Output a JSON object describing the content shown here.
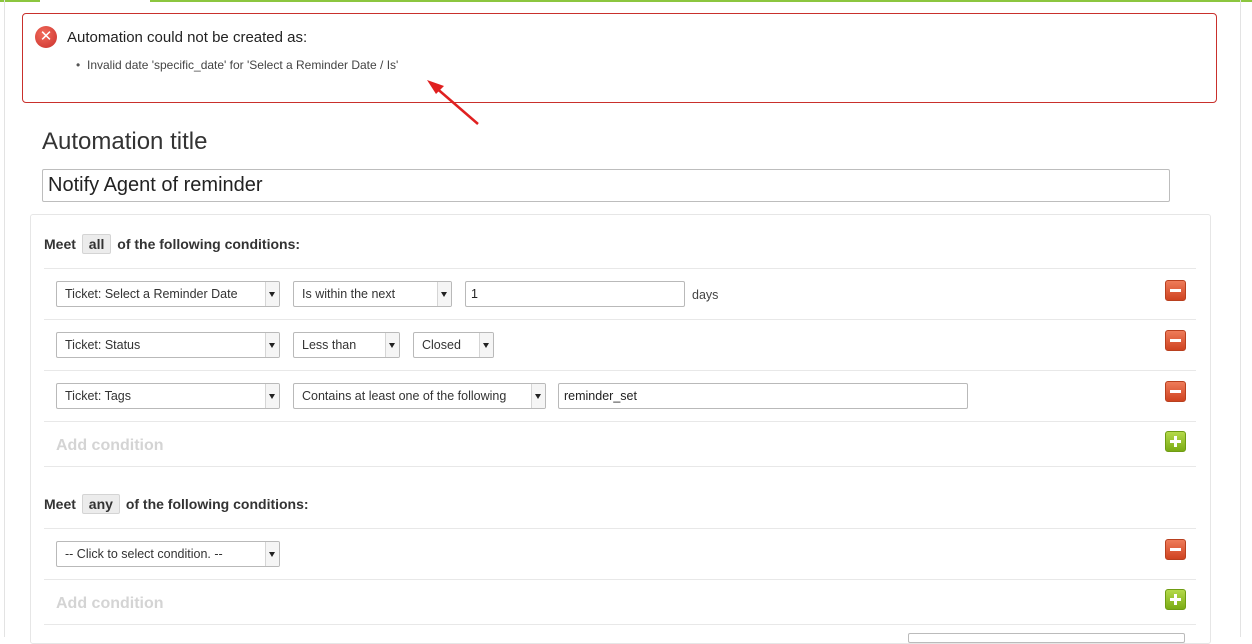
{
  "error": {
    "title": "Automation could not be created as:",
    "items": [
      "Invalid date 'specific_date' for 'Select a Reminder Date / Is'"
    ],
    "icon": "error-circle-icon",
    "color": "#c9302c"
  },
  "form": {
    "title_label": "Automation title",
    "title_value": "Notify Agent of reminder"
  },
  "all_group": {
    "prefix": "Meet",
    "mode": "all",
    "suffix": "of the following conditions:",
    "conditions": [
      {
        "field": "Ticket: Select a Reminder Date",
        "operator": "Is within the next",
        "value": "1",
        "unit": "days"
      },
      {
        "field": "Ticket: Status",
        "operator": "Less than",
        "value": "Closed"
      },
      {
        "field": "Ticket: Tags",
        "operator": "Contains at least one of the following",
        "value": "reminder_set"
      }
    ],
    "add_label": "Add condition"
  },
  "any_group": {
    "prefix": "Meet",
    "mode": "any",
    "suffix": "of the following conditions:",
    "conditions": [
      {
        "field": "-- Click to select condition. --"
      }
    ],
    "add_label": "Add condition"
  },
  "colors": {
    "accent": "#8cc63f",
    "remove": "#cf4320",
    "add": "#7aab15"
  }
}
